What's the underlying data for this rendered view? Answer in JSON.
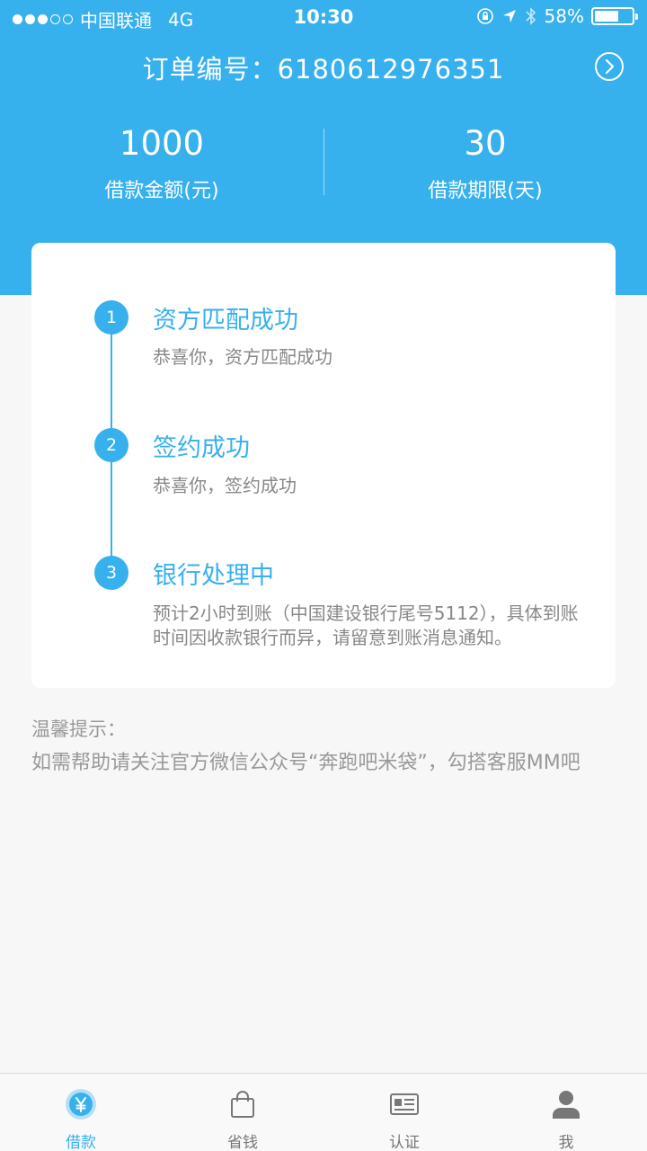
{
  "status_bar": {
    "carrier": "中国联通",
    "network": "4G",
    "time": "10:30",
    "battery": "58%",
    "battery_level": 0.58
  },
  "header": {
    "order_label": "订单编号：6180612976351",
    "amount": "1000",
    "amount_label": "借款金额(元)",
    "term": "30",
    "term_label": "借款期限(天)"
  },
  "steps": [
    {
      "number": "1",
      "title": "资方匹配成功",
      "desc": "恭喜你，资方匹配成功"
    },
    {
      "number": "2",
      "title": "签约成功",
      "desc": "恭喜你，签约成功"
    },
    {
      "number": "3",
      "title": "银行处理中",
      "desc": "预计2小时到账（中国建设银行尾号5112），具体到账时间因收款银行而异，请留意到账消息通知。"
    }
  ],
  "tip": {
    "heading": "温馨提示：",
    "text": "如需帮助请关注官方微信公众号“奔跑吧米袋”，勾搭客服MM吧"
  },
  "tabbar": {
    "items": [
      {
        "label": "借款",
        "icon": "yuan-icon",
        "active": true
      },
      {
        "label": "省钱",
        "icon": "bag-icon",
        "active": false
      },
      {
        "label": "认证",
        "icon": "id-card-icon",
        "active": false
      },
      {
        "label": "我",
        "icon": "user-icon",
        "active": false
      }
    ]
  },
  "colors": {
    "accent": "#37b0ee",
    "background": "#f7f7f7",
    "inactive": "#777777"
  }
}
